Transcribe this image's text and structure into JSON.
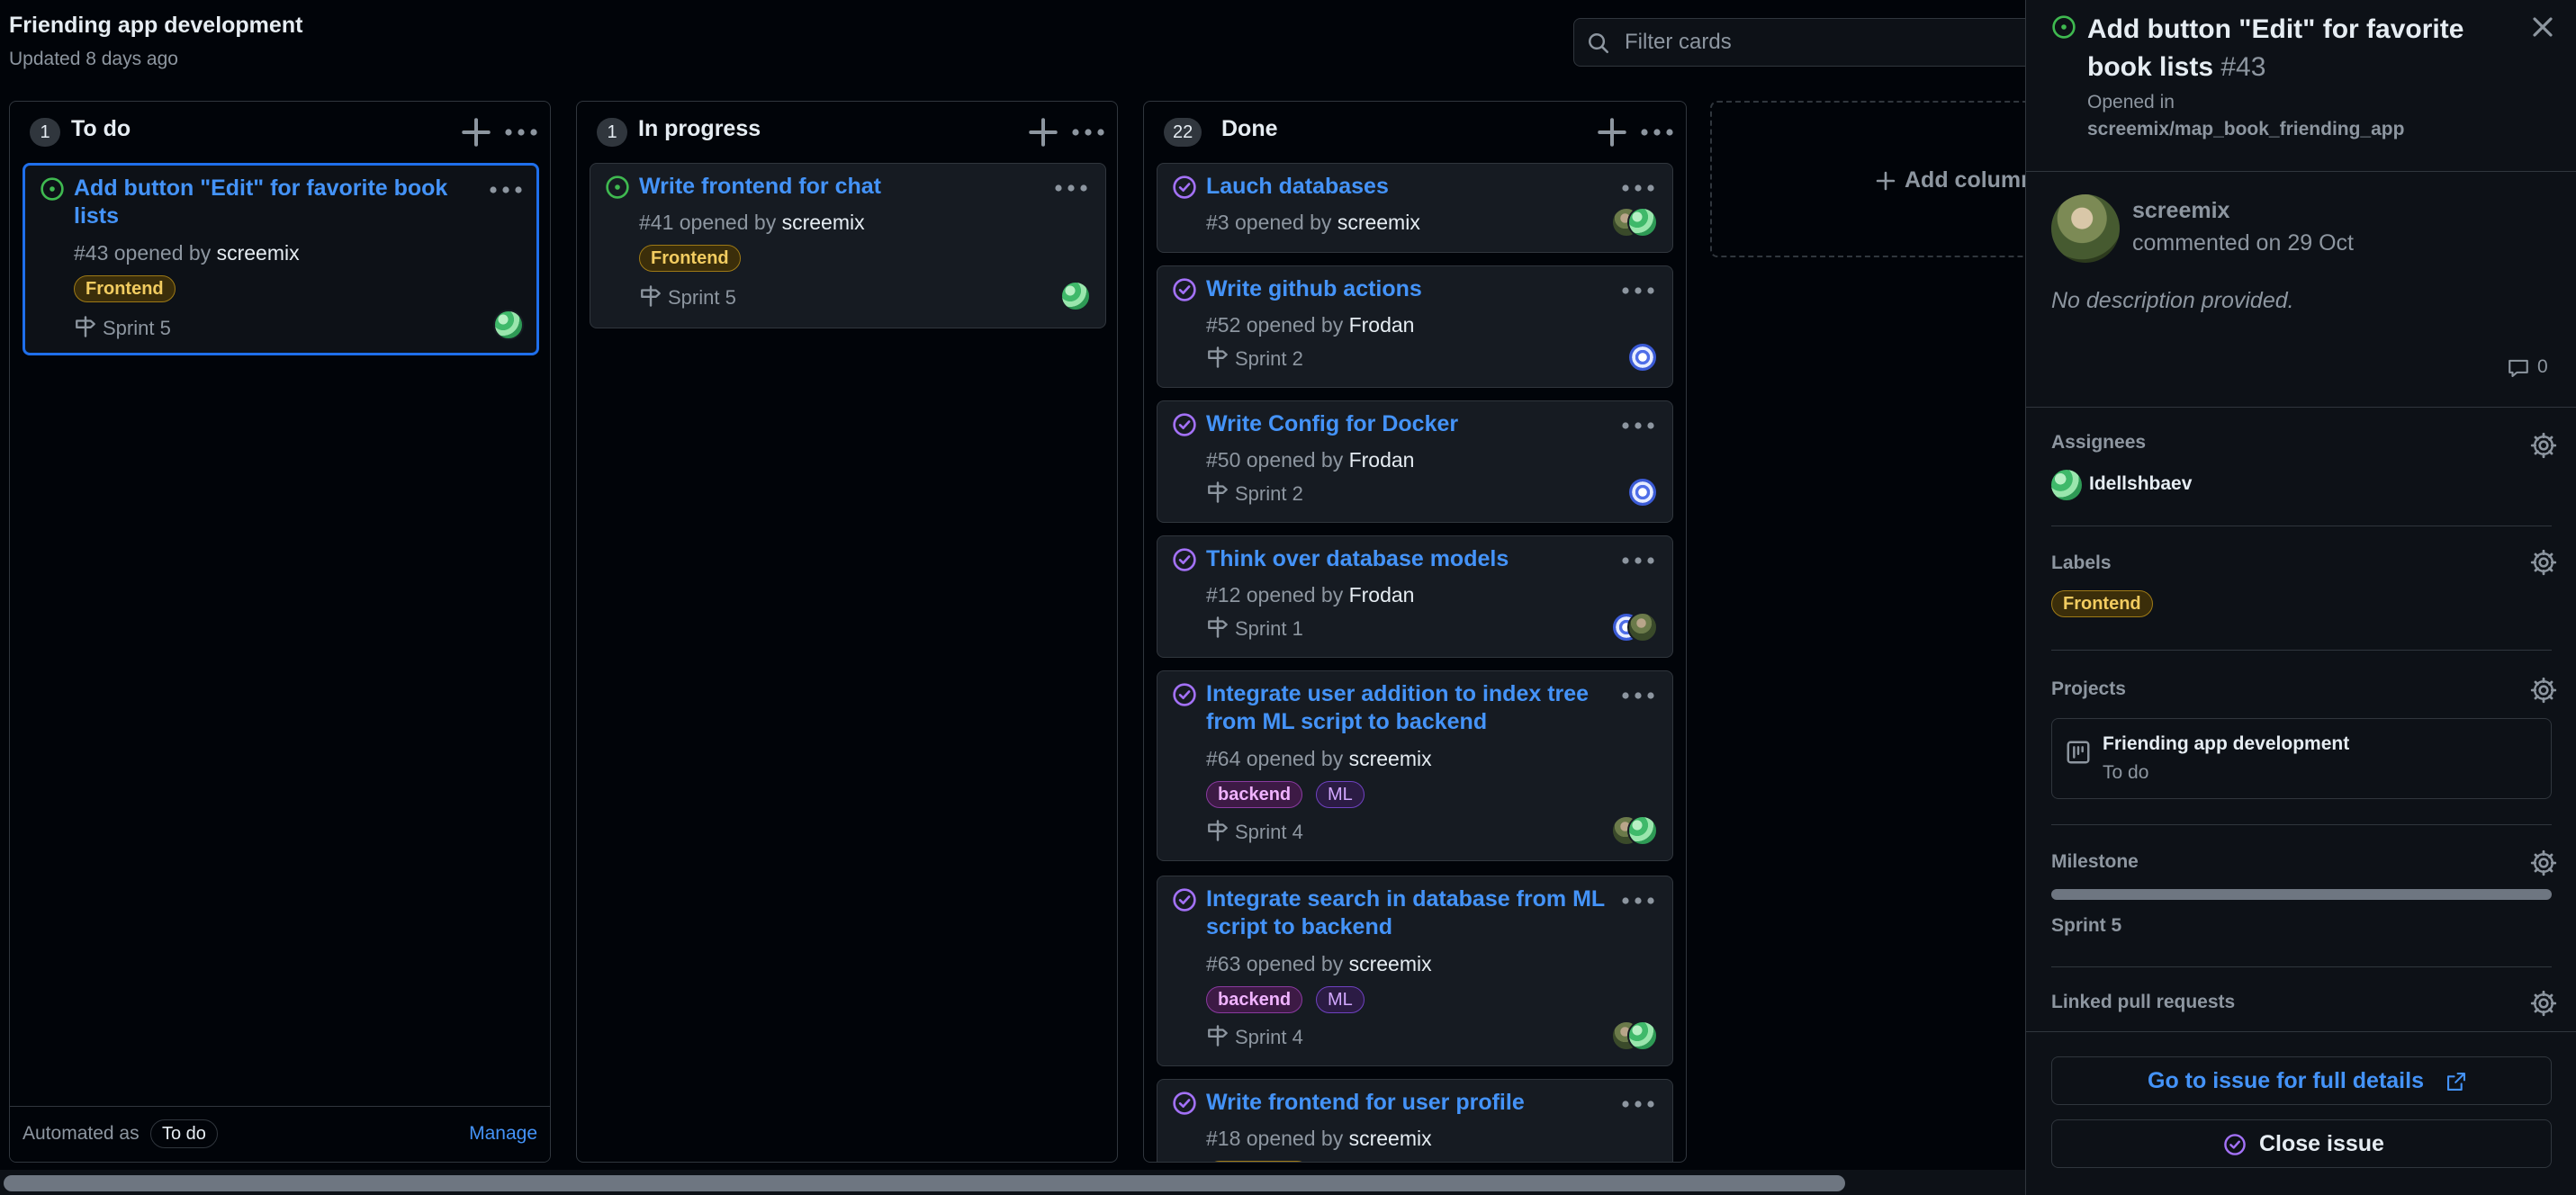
{
  "board": {
    "title": "Friending app development",
    "updated": "Updated 8 days ago",
    "filter_placeholder": "Filter cards"
  },
  "columns": [
    {
      "count": "1",
      "name": "To do",
      "automated_label": "Automated as",
      "automated_value": "To do",
      "manage_label": "Manage",
      "cards": [
        {
          "title_line1": "Add button \"Edit\" for favorite book",
          "title_line2": "lists",
          "number": "#43",
          "opened_by": "opened by",
          "author": "screemix",
          "label": "Frontend",
          "milestone": "Sprint 5",
          "state": "open"
        }
      ]
    },
    {
      "count": "1",
      "name": "In progress",
      "cards": [
        {
          "title_line1": "Write frontend for chat",
          "number": "#41",
          "opened_by": "opened by",
          "author": "screemix",
          "label": "Frontend",
          "milestone": "Sprint 5",
          "state": "open"
        }
      ]
    },
    {
      "count": "22",
      "name": "Done",
      "cards": [
        {
          "title_line1": "Lauch databases",
          "number": "#3",
          "opened_by": "opened by",
          "author": "screemix"
        },
        {
          "title_line1": "Write github actions",
          "number": "#52",
          "opened_by": "opened by",
          "author": "Frodan",
          "milestone": "Sprint 2"
        },
        {
          "title_line1": "Write Config for Docker",
          "number": "#50",
          "opened_by": "opened by",
          "author": "Frodan",
          "milestone": "Sprint 2"
        },
        {
          "title_line1": "Think over database models",
          "number": "#12",
          "opened_by": "opened by",
          "author": "Frodan",
          "milestone": "Sprint 1"
        },
        {
          "title_line1": "Integrate user addition to index tree",
          "title_line2": "from ML script to backend",
          "number": "#64",
          "opened_by": "opened by",
          "author": "screemix",
          "labels": [
            "backend",
            "ML"
          ],
          "milestone": "Sprint 4"
        },
        {
          "title_line1": "Integrate search in database from ML",
          "title_line2": "script to backend",
          "number": "#63",
          "opened_by": "opened by",
          "author": "screemix",
          "labels": [
            "backend",
            "ML"
          ],
          "milestone": "Sprint 4"
        },
        {
          "title_line1": "Write frontend for user profile",
          "number": "#18",
          "opened_by": "opened by",
          "author": "screemix"
        }
      ]
    }
  ],
  "add_column_label": "Add column",
  "panel": {
    "title": "Add button \"Edit\" for favorite book lists",
    "number": "#43",
    "opened_in": "Opened in",
    "repo": "screemix/map_book_friending_app",
    "author": "screemix",
    "commented": "commented on 29 Oct",
    "description": "No description provided.",
    "comment_count": "0",
    "assignees_label": "Assignees",
    "assignee": "Idellshbaev",
    "labels_label": "Labels",
    "label": "Frontend",
    "projects_label": "Projects",
    "project_name": "Friending app development",
    "project_column": "To do",
    "milestone_label": "Milestone",
    "milestone_progress": 0,
    "milestone": "Sprint 5",
    "linked_label": "Linked pull requests",
    "go_button": "Go to issue for full details",
    "close_button": "Close issue"
  },
  "colors": {
    "accent_link": "#4493f8",
    "open_state": "#3fb950",
    "done_state": "#a371f7",
    "frontend_label": "#f2cc60",
    "backend_label": "#f0b3ff",
    "ml_label": "#d2a8ff"
  },
  "icons": {
    "filter": "search-icon",
    "add": "plus-icon",
    "more": "kebab-horizontal-icon",
    "milestone": "milestone-icon",
    "close": "x-icon",
    "comment": "comment-icon",
    "settings": "gear-icon",
    "project": "project-icon",
    "external": "link-external-icon",
    "close_issue": "issue-closed-icon"
  }
}
